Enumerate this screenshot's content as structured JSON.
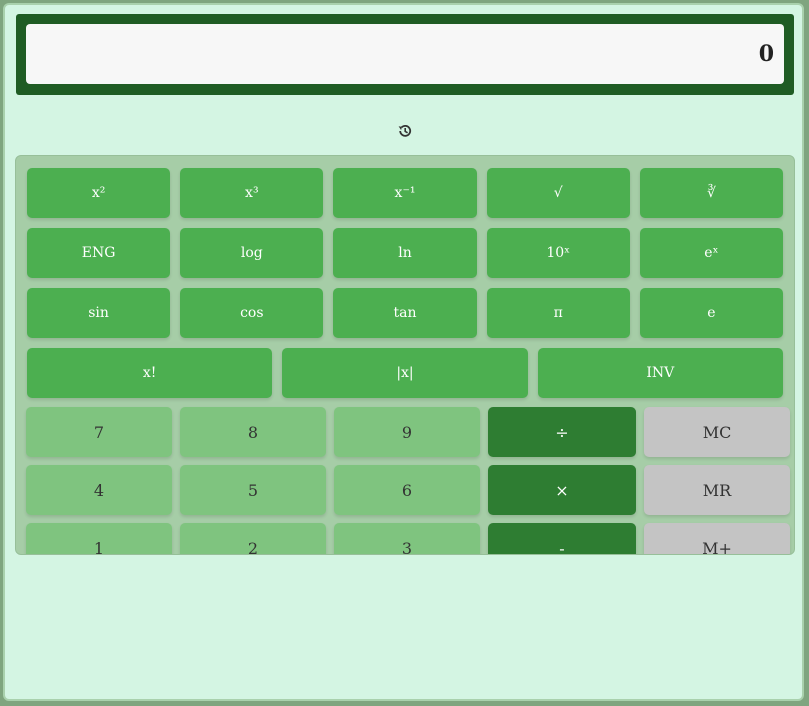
{
  "display": {
    "value": "0"
  },
  "history": {
    "icon": "history-icon"
  },
  "sci_rows": [
    [
      "x²",
      "x³",
      "x⁻¹",
      "√",
      "∛"
    ],
    [
      "ENG",
      "log",
      "ln",
      "10ˣ",
      "eˣ"
    ],
    [
      "sin",
      "cos",
      "tan",
      "π",
      "e"
    ],
    [
      "x!",
      "|x|",
      "INV"
    ]
  ],
  "basic_rows": [
    [
      "7",
      "8",
      "9",
      "÷",
      "MC"
    ],
    [
      "4",
      "5",
      "6",
      "×",
      "MR"
    ],
    [
      "1",
      "2",
      "3",
      "-",
      "M+"
    ]
  ],
  "colors": {
    "display_frame": "#1f5c24",
    "scientific_key": "#4caf50",
    "number_key": "#7fc47f",
    "operator_key": "#2e7d32",
    "memory_key": "#c4c4c4",
    "background": "#d4f5e3"
  }
}
